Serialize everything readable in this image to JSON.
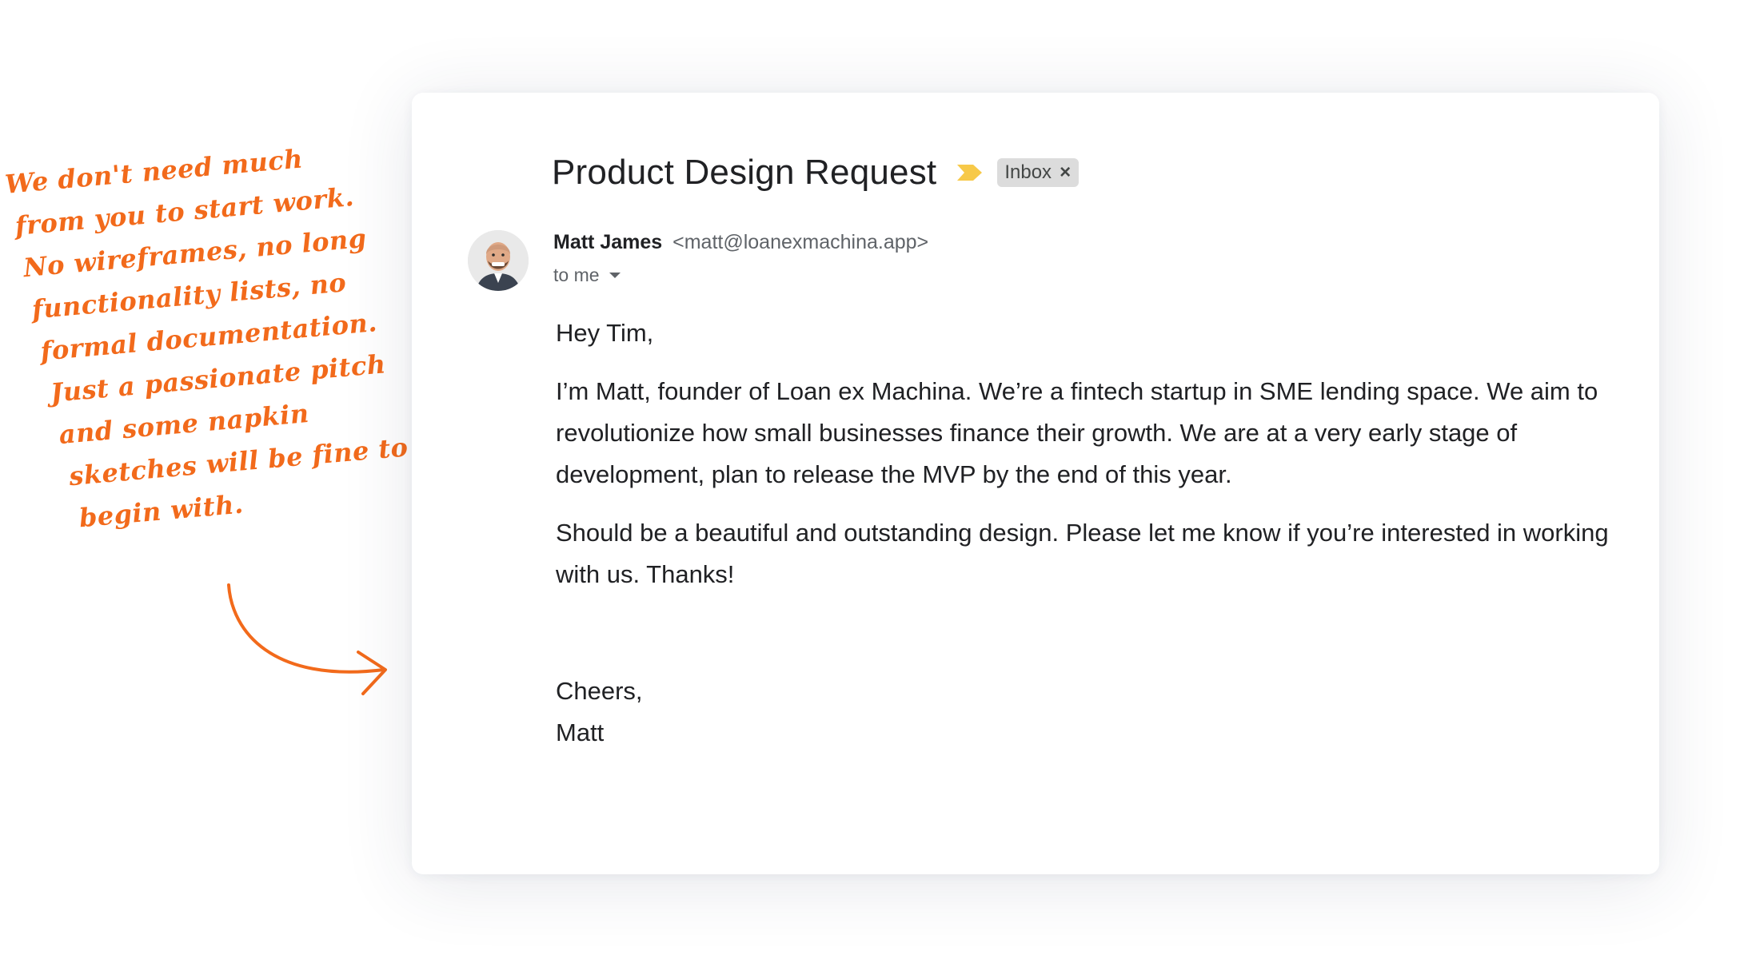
{
  "annotation": {
    "lines": [
      "We don't need much",
      "from you to start work.",
      "No wireframes, no long",
      "functionality lists, no",
      "formal documentation.",
      "Just a passionate pitch",
      "and some napkin",
      "sketches will be fine to",
      "begin with."
    ]
  },
  "email": {
    "subject": "Product Design Request",
    "label": "Inbox",
    "label_close": "×",
    "sender_name": "Matt James",
    "sender_email": "<matt@loanexmachina.app>",
    "recipient": "to me",
    "greeting": "Hey Tim,",
    "paragraph_1": "I’m Matt, founder of Loan ex Machina. We’re a fintech startup in SME lending space. We aim to revolutionize how small businesses finance their growth. We are at a very early stage of development, plan to release the MVP by the end of this year.",
    "paragraph_2": "Should be a beautiful and outstanding design. Please let me know if you’re interested in working with us. Thanks!",
    "closing": "Cheers,",
    "signature": "Matt"
  },
  "colors": {
    "annotation": "#f26a1b",
    "important_marker": "#f7c948",
    "label_chip": "#dcdcdc"
  },
  "icons": {
    "important": "important-marker-icon",
    "avatar": "sender-avatar",
    "dropdown": "chevron-down-icon",
    "arrow": "hand-drawn-arrow"
  }
}
